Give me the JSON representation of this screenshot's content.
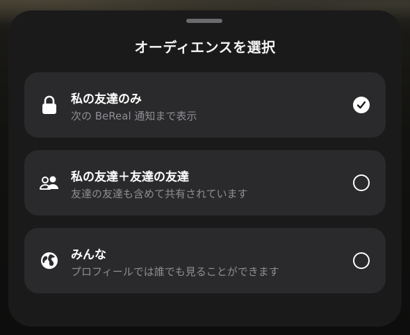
{
  "sheet": {
    "title": "オーディエンスを選択"
  },
  "options": [
    {
      "title": "私の友達のみ",
      "subtitle": "次の BeReal 通知まで表示",
      "icon": "lock-icon",
      "selected": true
    },
    {
      "title": "私の友達＋友達の友達",
      "subtitle": "友達の友達も含めて共有されています",
      "icon": "friends-icon",
      "selected": false
    },
    {
      "title": "みんな",
      "subtitle": "プロフィールでは誰でも見ることができます",
      "icon": "globe-icon",
      "selected": false
    }
  ],
  "colors": {
    "sheet_bg": "#1a1a1b",
    "card_bg": "#2a2a2c",
    "primary_text": "#ffffff",
    "secondary_text": "#8e8e93"
  }
}
